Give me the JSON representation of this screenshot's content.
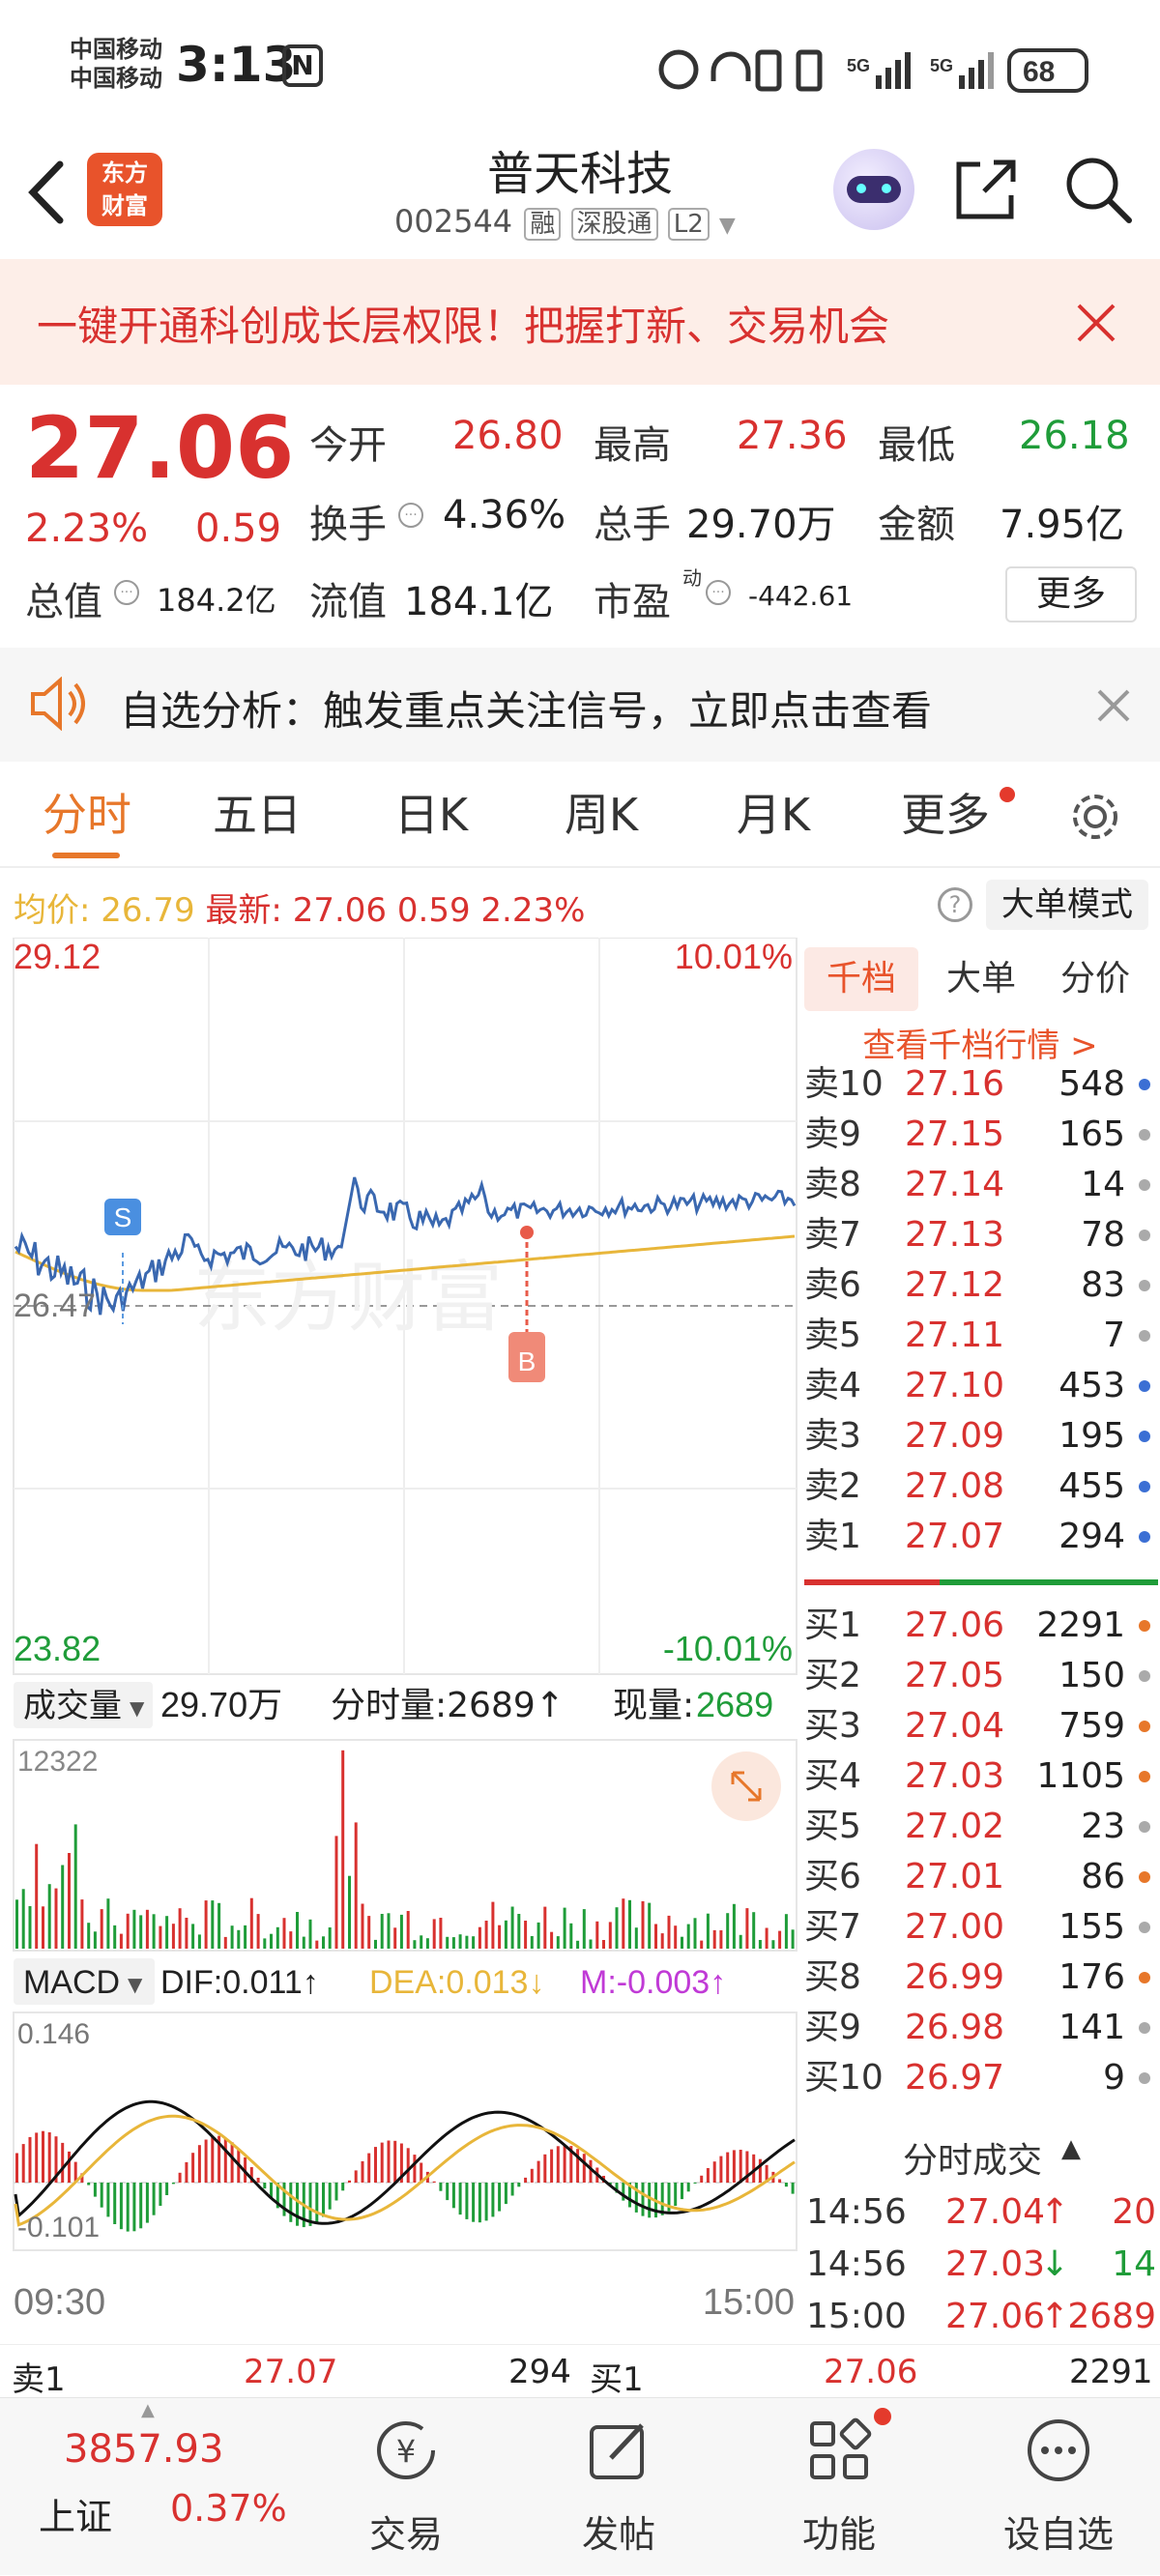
{
  "status_bar": {
    "carrier1": "中国移动",
    "carrier2": "中国移动",
    "time": "3:13",
    "net1": "5G",
    "net2": "5G",
    "battery": "68"
  },
  "header": {
    "logo_line1": "东方",
    "logo_line2": "财富",
    "title": "普天科技",
    "code": "002544",
    "badges": [
      "融",
      "深股通",
      "L2"
    ]
  },
  "banner": {
    "text": "一键开通科创成长层权限！把握打新、交易机会"
  },
  "quote": {
    "price": "27.06",
    "change_pct": "2.23%",
    "change": "0.59",
    "open_label": "今开",
    "open": "26.80",
    "high_label": "最高",
    "high": "27.36",
    "low_label": "最低",
    "low": "26.18",
    "turnover_label": "换手",
    "turnover": "4.36%",
    "volume_label": "总手",
    "volume": "29.70万",
    "amount_label": "金额",
    "amount": "7.95亿",
    "mktcap_label": "总值",
    "mktcap": "184.2亿",
    "float_label": "流值",
    "float_cap": "184.1亿",
    "pe_label": "市盈",
    "pe_sup": "动",
    "pe": "-442.61",
    "more_button": "更多"
  },
  "alert": {
    "text": "自选分析：触发重点关注信号，立即点击查看"
  },
  "tabs": [
    "分时",
    "五日",
    "日K",
    "周K",
    "月K",
    "更多"
  ],
  "price_bar": {
    "avg_label": "均价:",
    "avg": "26.79",
    "last_label": "最新:",
    "last": "27.06",
    "chg": "0.59",
    "pct": "2.23%",
    "mode_button": "大单模式"
  },
  "chart": {
    "ymax": "29.12",
    "ymin": "23.82",
    "pmax": "10.01%",
    "pmin": "-10.01%",
    "ref": "26.47",
    "s_marker": "S",
    "b_marker": "B",
    "t_start": "09:30",
    "t_end": "15:00"
  },
  "volume_panel": {
    "label": "成交量",
    "total": "29.70万",
    "tick_label": "分时量:2689↑",
    "now_label": "现量:",
    "now": "2689",
    "max": "12322"
  },
  "macd_panel": {
    "label": "MACD",
    "dif": "DIF:0.011↑",
    "dea": "DEA:0.013↓",
    "m": "M:-0.003↑",
    "top": "0.146",
    "bottom": "-0.101"
  },
  "orderbook": {
    "tabs": [
      "千档",
      "大单",
      "分价"
    ],
    "link": "查看千档行情 >",
    "asks": [
      {
        "label": "卖10",
        "price": "27.16",
        "vol": "548",
        "dot": "#3b6fd4"
      },
      {
        "label": "卖9",
        "price": "27.15",
        "vol": "165",
        "dot": "#aaaaaa"
      },
      {
        "label": "卖8",
        "price": "27.14",
        "vol": "14",
        "dot": "#aaaaaa"
      },
      {
        "label": "卖7",
        "price": "27.13",
        "vol": "78",
        "dot": "#aaaaaa"
      },
      {
        "label": "卖6",
        "price": "27.12",
        "vol": "83",
        "dot": "#aaaaaa"
      },
      {
        "label": "卖5",
        "price": "27.11",
        "vol": "7",
        "dot": "#aaaaaa"
      },
      {
        "label": "卖4",
        "price": "27.10",
        "vol": "453",
        "dot": "#3b6fd4"
      },
      {
        "label": "卖3",
        "price": "27.09",
        "vol": "195",
        "dot": "#3b6fd4"
      },
      {
        "label": "卖2",
        "price": "27.08",
        "vol": "455",
        "dot": "#3b6fd4"
      },
      {
        "label": "卖1",
        "price": "27.07",
        "vol": "294",
        "dot": "#3b6fd4"
      }
    ],
    "bids": [
      {
        "label": "买1",
        "price": "27.06",
        "vol": "2291",
        "dot": "#e7772a"
      },
      {
        "label": "买2",
        "price": "27.05",
        "vol": "150",
        "dot": "#aaaaaa"
      },
      {
        "label": "买3",
        "price": "27.04",
        "vol": "759",
        "dot": "#e7772a"
      },
      {
        "label": "买4",
        "price": "27.03",
        "vol": "1105",
        "dot": "#e7772a"
      },
      {
        "label": "买5",
        "price": "27.02",
        "vol": "23",
        "dot": "#aaaaaa"
      },
      {
        "label": "买6",
        "price": "27.01",
        "vol": "86",
        "dot": "#e7772a"
      },
      {
        "label": "买7",
        "price": "27.00",
        "vol": "155",
        "dot": "#aaaaaa"
      },
      {
        "label": "买8",
        "price": "26.99",
        "vol": "176",
        "dot": "#e7772a"
      },
      {
        "label": "买9",
        "price": "26.98",
        "vol": "141",
        "dot": "#aaaaaa"
      },
      {
        "label": "买10",
        "price": "26.97",
        "vol": "9",
        "dot": "#aaaaaa"
      }
    ]
  },
  "trades": {
    "title": "分时成交",
    "rows": [
      {
        "time": "14:56",
        "price": "27.04",
        "arrow": "↑",
        "vol": "20",
        "color": "red"
      },
      {
        "time": "14:56",
        "price": "27.03",
        "arrow": "↓",
        "vol": "14",
        "color": "green"
      },
      {
        "time": "15:00",
        "price": "27.06",
        "arrow": "↑",
        "vol": "2689",
        "color": "red"
      }
    ]
  },
  "bottom_row": {
    "ask_label": "卖1",
    "ask_price": "27.07",
    "ask_vol": "294",
    "bid_label": "买1",
    "bid_price": "27.06",
    "bid_vol": "2291"
  },
  "nav": {
    "index_value": "3857.93",
    "index_name": "上证",
    "index_pct": "0.37%",
    "items": [
      "交易",
      "发帖",
      "功能",
      "设自选"
    ]
  },
  "colors": {
    "up": "#d8312f",
    "down": "#1f9c39",
    "accent": "#e7772a",
    "price_line": "#3a68b0",
    "avg_line": "#e8b63a"
  }
}
